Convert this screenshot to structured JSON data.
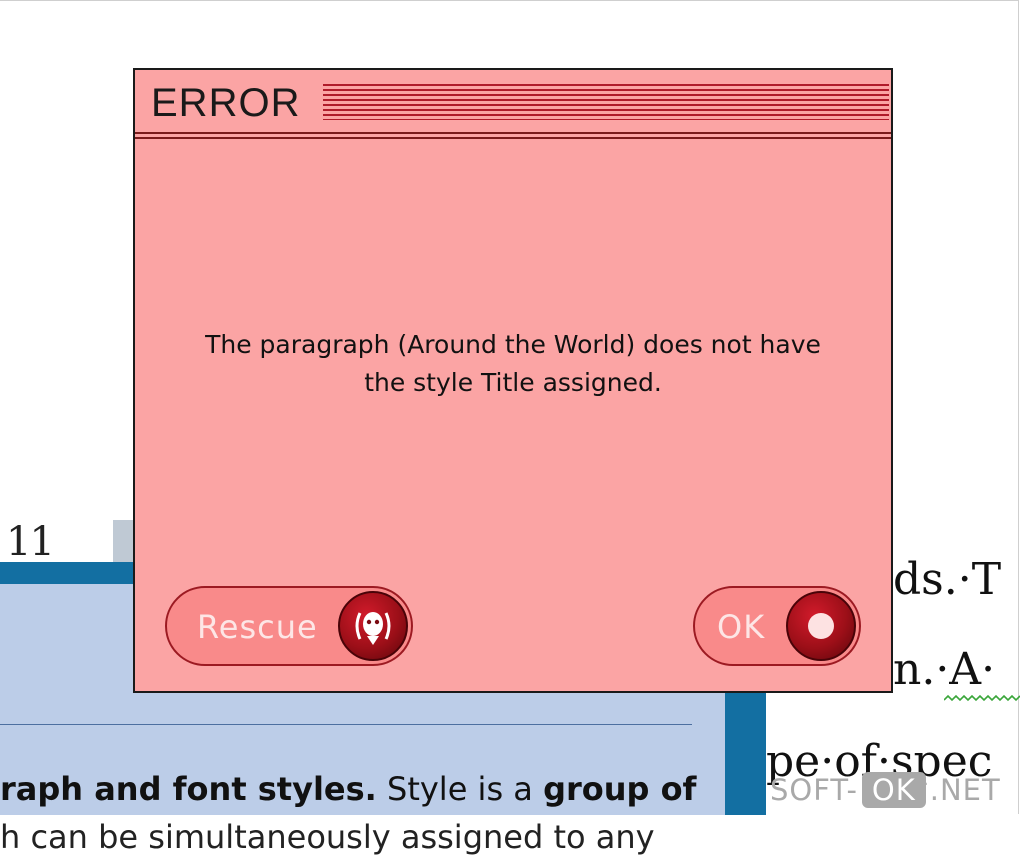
{
  "document": {
    "partial_left": "11",
    "line1_bold_a": "raph and font styles.",
    "line1_plain": " Style is a ",
    "line1_bold_b": "group of",
    "line2": "h can be simultaneously assigned to any",
    "right_line1": "ds.·T",
    "right_line2": "n.·A·",
    "right_line3": "pe·of·spec"
  },
  "dialog": {
    "title": "ERROR",
    "message": "The paragraph (Around the World) does not have\nthe style Title assigned.",
    "buttons": {
      "rescue_label": "Rescue",
      "ok_label": "OK"
    }
  },
  "watermark": {
    "left": "SOFT-",
    "middle": "OK",
    "right": ".NET"
  },
  "colors": {
    "dialog_bg": "#fba4a4",
    "stripe": "#b01b2a",
    "button_bg": "#f98a8a",
    "orb": "#9c0f18",
    "doc_panel": "#bccde8",
    "doc_accent": "#136fa2"
  }
}
